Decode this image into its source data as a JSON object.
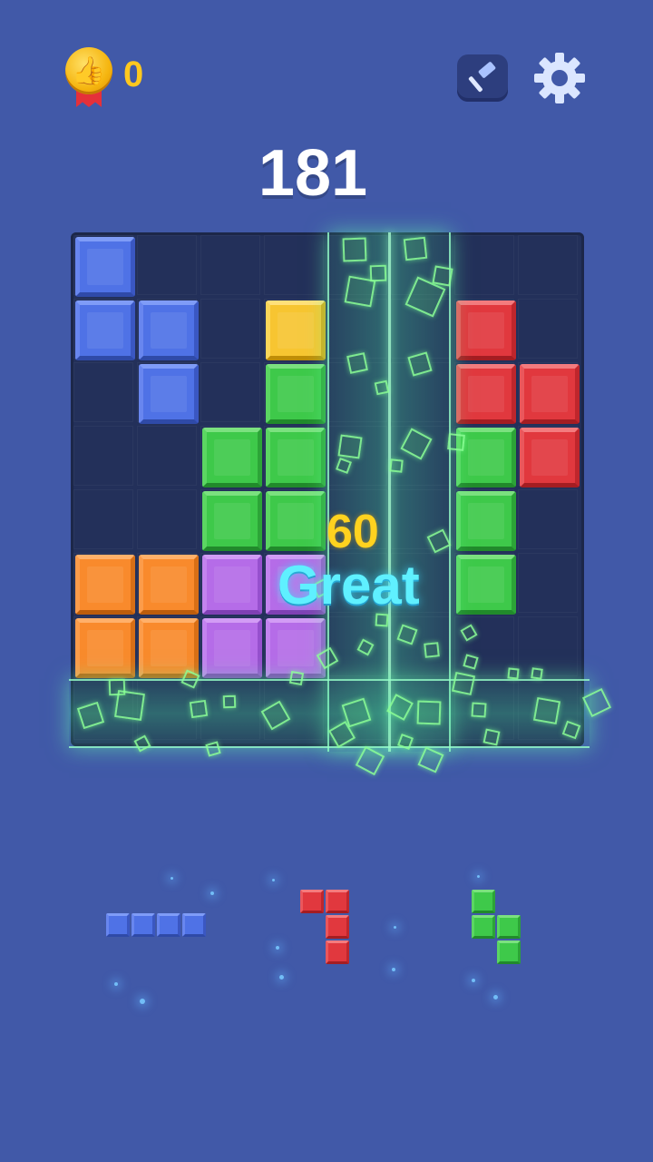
{
  "header": {
    "likes_count": "0",
    "medal_icon": "thumbs-up-medal-icon",
    "hammer_icon": "hammer-icon",
    "settings_icon": "gear-icon"
  },
  "score": "181",
  "combo": {
    "points": "60",
    "word": "Great"
  },
  "board": {
    "grid_size": 8,
    "blocks": [
      {
        "row": 0,
        "col": 0,
        "color": "blue"
      },
      {
        "row": 1,
        "col": 0,
        "color": "blue"
      },
      {
        "row": 1,
        "col": 1,
        "color": "blue"
      },
      {
        "row": 2,
        "col": 1,
        "color": "blue"
      },
      {
        "row": 1,
        "col": 3,
        "color": "yellow"
      },
      {
        "row": 2,
        "col": 3,
        "color": "green"
      },
      {
        "row": 3,
        "col": 2,
        "color": "green"
      },
      {
        "row": 3,
        "col": 3,
        "color": "green"
      },
      {
        "row": 4,
        "col": 2,
        "color": "green"
      },
      {
        "row": 4,
        "col": 3,
        "color": "green"
      },
      {
        "row": 1,
        "col": 6,
        "color": "red"
      },
      {
        "row": 2,
        "col": 6,
        "color": "red"
      },
      {
        "row": 2,
        "col": 7,
        "color": "red"
      },
      {
        "row": 3,
        "col": 7,
        "color": "red"
      },
      {
        "row": 3,
        "col": 6,
        "color": "green"
      },
      {
        "row": 4,
        "col": 6,
        "color": "green"
      },
      {
        "row": 5,
        "col": 6,
        "color": "green"
      },
      {
        "row": 5,
        "col": 0,
        "color": "orange"
      },
      {
        "row": 5,
        "col": 1,
        "color": "orange"
      },
      {
        "row": 6,
        "col": 0,
        "color": "orange"
      },
      {
        "row": 6,
        "col": 1,
        "color": "orange"
      },
      {
        "row": 5,
        "col": 2,
        "color": "purple"
      },
      {
        "row": 5,
        "col": 3,
        "color": "purple"
      },
      {
        "row": 6,
        "col": 2,
        "color": "purple"
      },
      {
        "row": 6,
        "col": 3,
        "color": "purple"
      }
    ],
    "cleared_columns": [
      4,
      5
    ],
    "cleared_rows": [
      7
    ]
  },
  "tray": [
    {
      "name": "blue-i-piece",
      "color": "blue",
      "cells": [
        [
          0,
          0
        ],
        [
          0,
          1
        ],
        [
          0,
          2
        ],
        [
          0,
          3
        ]
      ]
    },
    {
      "name": "red-l-piece",
      "color": "red",
      "cells": [
        [
          0,
          0
        ],
        [
          0,
          1
        ],
        [
          1,
          1
        ],
        [
          2,
          1
        ]
      ]
    },
    {
      "name": "green-s-piece",
      "color": "green",
      "cells": [
        [
          0,
          0
        ],
        [
          1,
          0
        ],
        [
          1,
          1
        ],
        [
          2,
          1
        ]
      ]
    }
  ],
  "colors": {
    "background": "#4159a8",
    "board": "#23305a",
    "score_text": "#ffffff",
    "likes_text": "#ffc81e",
    "combo_points": "#ffd21f",
    "combo_word": "#5ff0ff",
    "clear_glow": "#7dffb0"
  }
}
